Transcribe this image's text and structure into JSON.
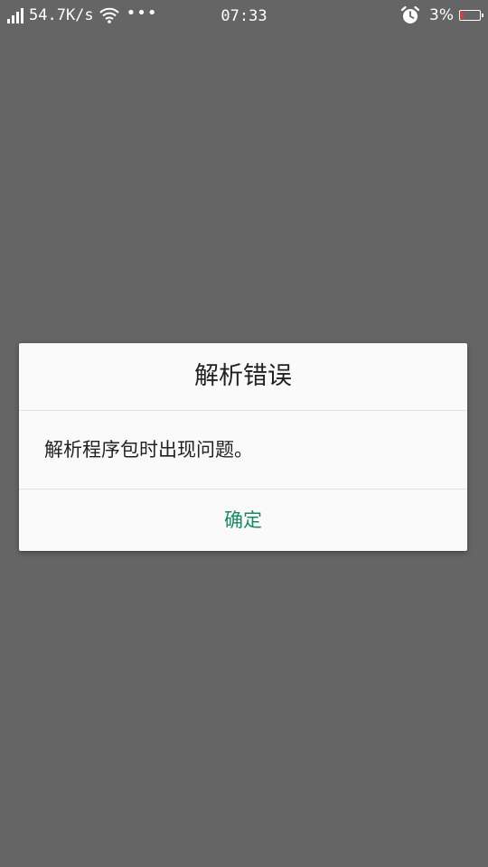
{
  "status_bar": {
    "net_speed": "54.7K/s",
    "more_dots": "•••",
    "time": "07:33",
    "battery_percent": "3%",
    "battery_level": 0.03,
    "icons": [
      "signal-icon",
      "wifi-icon",
      "alarm-icon",
      "battery-icon"
    ]
  },
  "dialog": {
    "title": "解析错误",
    "message": "解析程序包时出现问题。",
    "confirm_label": "确定"
  },
  "colors": {
    "overlay_background": "#656565",
    "dialog_background": "#fafafa",
    "accent_button": "#1a8a63",
    "battery_low": "#e53935"
  }
}
